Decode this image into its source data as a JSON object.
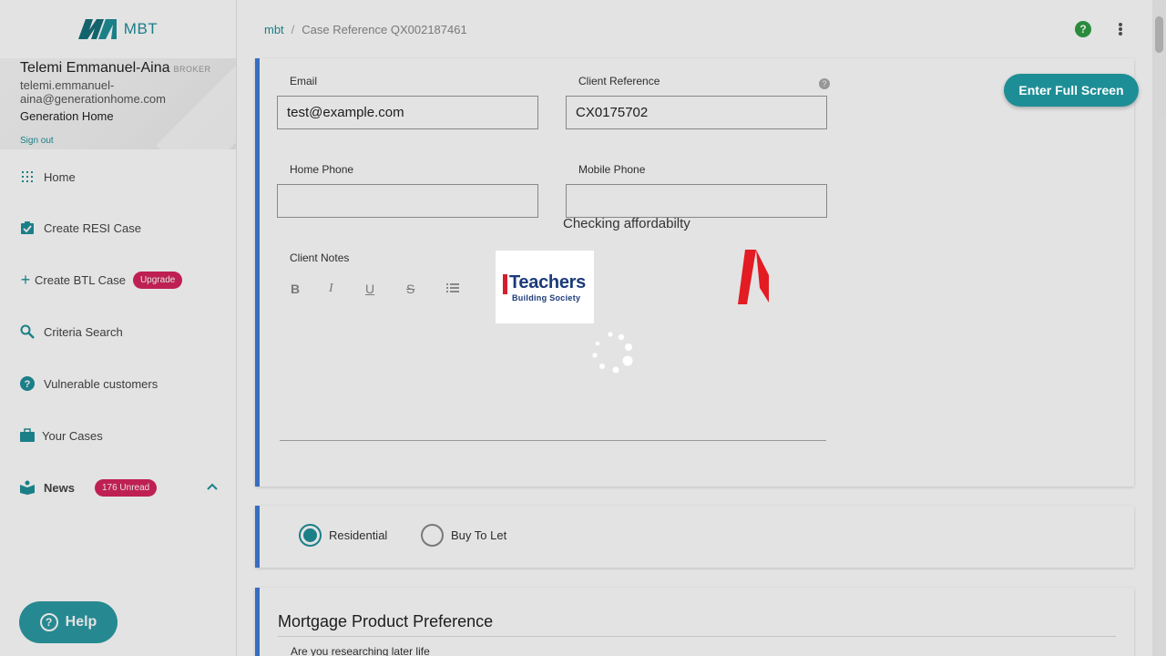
{
  "app": {
    "logo_text": "MBT",
    "accent": "#1f8f99"
  },
  "user": {
    "name": "Telemi Emmanuel-Aina",
    "role": "BROKER",
    "email_line1": "telemi.emmanuel-",
    "email_line2": "aina@generationhome.com",
    "company": "Generation Home",
    "sign_out": "Sign out"
  },
  "nav": {
    "home": "Home",
    "create_resi": "Create RESI Case",
    "create_btl": "Create BTL Case",
    "btl_badge": "Upgrade",
    "criteria": "Criteria Search",
    "vulnerable": "Vulnerable customers",
    "cases": "Your Cases",
    "news": "News",
    "news_badge": "176 Unread"
  },
  "help_button": "Help",
  "breadcrumb": {
    "root": "mbt",
    "separator": "/",
    "current": "Case Reference QX002187461"
  },
  "fullscreen_button": "Enter Full Screen",
  "form": {
    "email_label": "Email",
    "email_value": "test@example.com",
    "client_ref_label": "Client Reference",
    "client_ref_value": "CX0175702",
    "home_phone_label": "Home Phone",
    "home_phone_value": "",
    "mobile_phone_label": "Mobile Phone",
    "mobile_phone_value": "",
    "notes_label": "Client Notes",
    "toolbar": {
      "bold": "B",
      "italic": "I",
      "underline": "U",
      "strike": "S"
    }
  },
  "case_type": {
    "residential": "Residential",
    "btl": "Buy To Let",
    "selected": "Residential"
  },
  "product_pref": {
    "title": "Mortgage Product Preference",
    "question": "Are you researching later life"
  },
  "loading": {
    "text": "Checking affordabilty",
    "lender_name": "Teachers",
    "lender_sub": "Building Society"
  }
}
